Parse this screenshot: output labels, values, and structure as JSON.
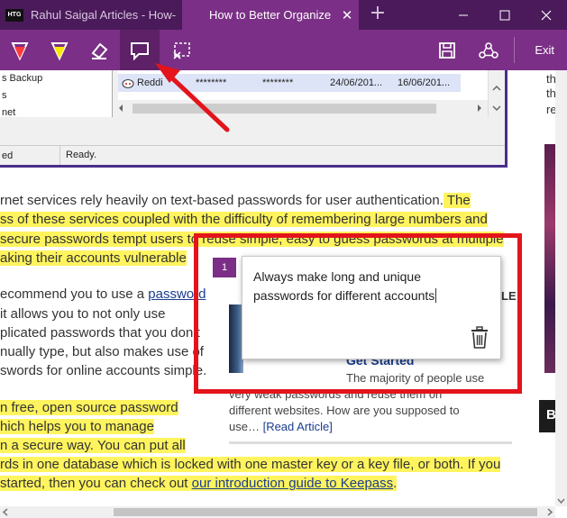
{
  "tabs": [
    {
      "favicon": "HTG",
      "label": "Rahul Saigal Articles - How-"
    },
    {
      "label": "How to Better Organize"
    }
  ],
  "window_controls": {
    "new_tab": "+",
    "minimize": "—",
    "maximize": "☐",
    "close": "✕"
  },
  "toolbar": {
    "tools": [
      "ballpoint-pen",
      "highlighter",
      "eraser",
      "add-note",
      "clip"
    ],
    "active_tool": "add-note",
    "exit_label": "Exit"
  },
  "embedded_app": {
    "tree_items": [
      "s Backup",
      "s",
      "net"
    ],
    "grid_row": {
      "title": "Reddi",
      "user": "********",
      "password": "********",
      "created": "24/06/201...",
      "modified": "16/06/201..."
    },
    "status_left": "ed",
    "status_right": "Ready."
  },
  "article": {
    "l1_plain": "rnet services rely heavily on text-based passwords for user authentication.",
    "l1_hl": " The",
    "l2_hl": "ss of these services coupled with the difficulty of remembering large numbers and",
    "l3_hl": "secure passwords tempt users to reuse simple, easy to guess passwords at multiple",
    "l4_hl": "aking their accounts vulnerable",
    "p2_l1_plain": "ecommend you to use a ",
    "p2_l1_link": "password",
    "p2_l2": " it allows you to not only use",
    "p2_l3": "plicated passwords that you don’t",
    "p2_l4": "nually type, but also makes use of",
    "p2_l5": "swords for online accounts simple.",
    "p3_l1_hl": "n free, open source password",
    "p3_l2_hl": "hich helps you to manage",
    "p3_l3_hl": "n a secure way. You can put all",
    "p3_l4_hl": "rds in one database which is locked with one master key or a key file, or both. If you",
    "p3_l5_hl_a": "started, then you can check out ",
    "p3_l5_link": "our introduction guide to Keepass",
    "p3_l5_end": "."
  },
  "related": {
    "heading": "Get Started",
    "badge_fragment": "LE",
    "line1": "The majority of people use",
    "line2": "very weak passwords and reuse them on",
    "line3": "different websites. How are you supposed to",
    "line4_a": "use… ",
    "line4_link": "[Read Article]"
  },
  "sidebar": {
    "t1": "th",
    "t2": "th",
    "t3": "re",
    "box": "B"
  },
  "note": {
    "number": "1",
    "text": "Always make long and unique passwords for different accounts"
  },
  "colors": {
    "tab_bar": "#4a1a5a",
    "toolbar": "#7b2f86",
    "highlight": "#fff028",
    "annotation_red": "#e3141b"
  }
}
